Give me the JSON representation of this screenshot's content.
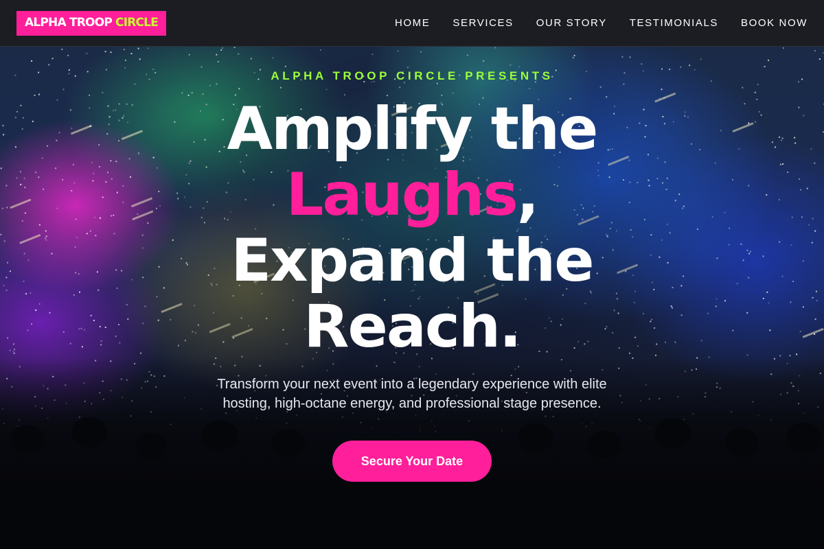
{
  "brand": {
    "part1": "ALPHA TROOP",
    "part2": "CIRCLE",
    "colors": {
      "pink": "#ff1f9a",
      "lime": "#c6ff2e",
      "eyebrow_green": "#9dff3a"
    }
  },
  "nav": {
    "items": [
      {
        "label": "HOME"
      },
      {
        "label": "SERVICES"
      },
      {
        "label": "OUR STORY"
      },
      {
        "label": "TESTIMONIALS"
      },
      {
        "label": "BOOK NOW"
      }
    ]
  },
  "hero": {
    "eyebrow": "ALPHA TROOP CIRCLE PRESENTS",
    "headline": {
      "line1": "Amplify the",
      "highlight": "Laughs",
      "after_highlight": ",",
      "line3": "Expand the",
      "line4": "Reach."
    },
    "subtext": "Transform your next event into a legendary experience with elite hosting, high-octane energy, and professional stage presence.",
    "cta_label": "Secure Your Date",
    "background": "concert-crowd-image"
  }
}
